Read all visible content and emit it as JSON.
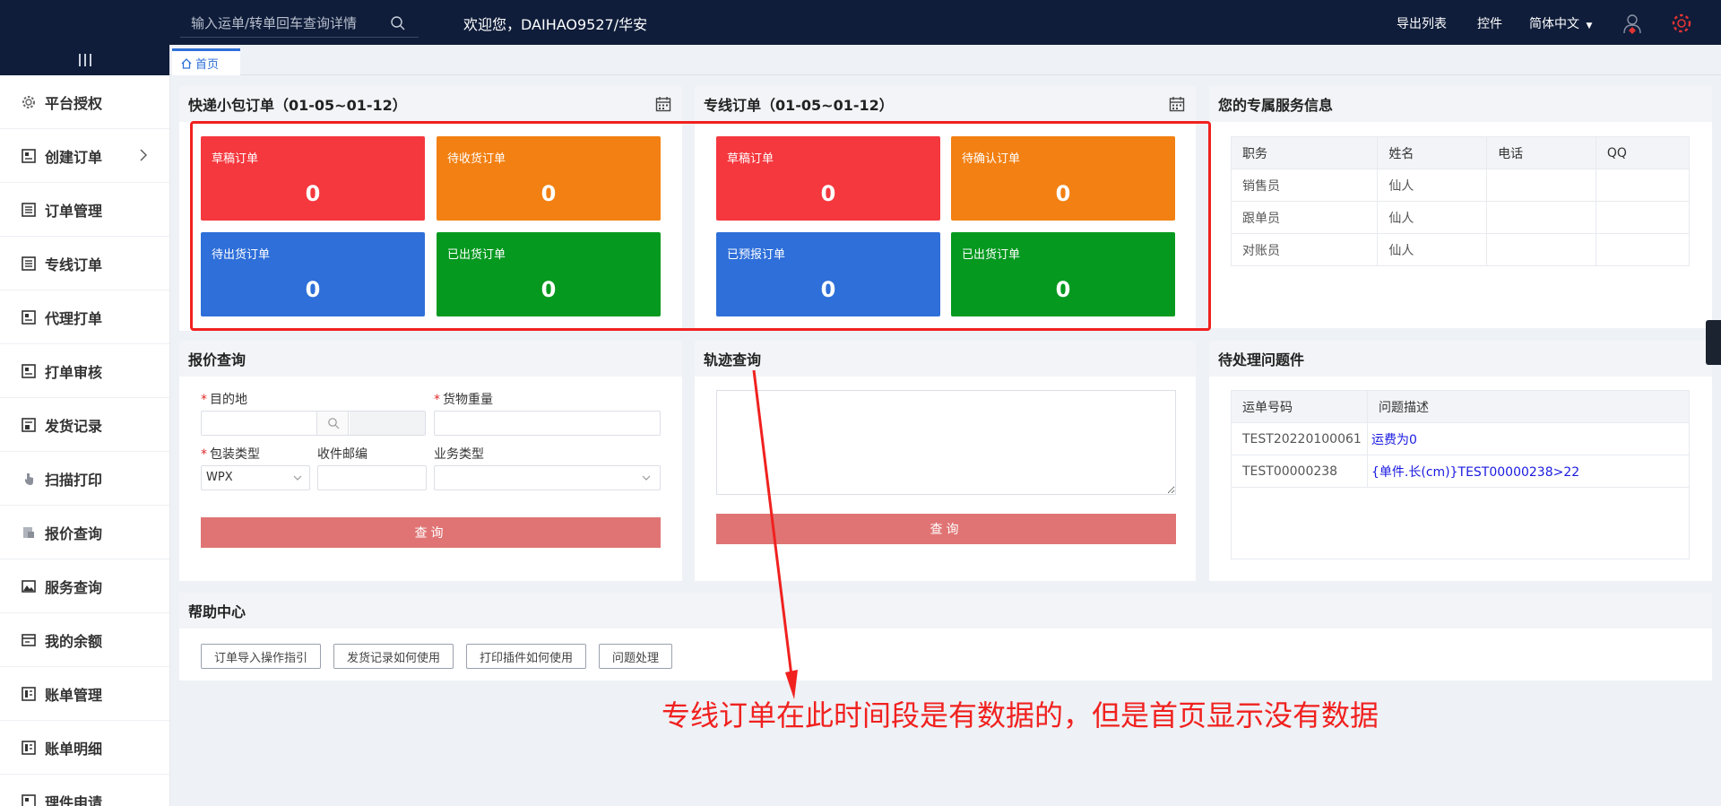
{
  "topbar": {
    "search_placeholder": "输入运单/转单回车查询详情",
    "welcome": "欢迎您，DAIHAO9527/华安",
    "links": [
      "导出列表",
      "控件",
      "简体中文"
    ]
  },
  "sidebar": {
    "items": [
      {
        "label": "平台授权",
        "icon": "gear-icon"
      },
      {
        "label": "创建订单",
        "icon": "form-icon",
        "has_arrow": true
      },
      {
        "label": "订单管理",
        "icon": "list-icon"
      },
      {
        "label": "专线订单",
        "icon": "list-icon"
      },
      {
        "label": "代理打单",
        "icon": "form-icon"
      },
      {
        "label": "打单审核",
        "icon": "form-icon"
      },
      {
        "label": "发货记录",
        "icon": "record-icon"
      },
      {
        "label": "扫描打印",
        "icon": "hand-icon"
      },
      {
        "label": "报价查询",
        "icon": "quote-icon"
      },
      {
        "label": "服务查询",
        "icon": "image-icon"
      },
      {
        "label": "我的余额",
        "icon": "wallet-icon"
      },
      {
        "label": "账单管理",
        "icon": "bill-icon"
      },
      {
        "label": "账单明细",
        "icon": "bill-icon"
      },
      {
        "label": "理件申请",
        "icon": "form-icon"
      }
    ]
  },
  "tabs": [
    {
      "label": "首页"
    }
  ],
  "express_panel": {
    "title": "快递小包订单（01-05~01-12）",
    "tiles": [
      {
        "label": "草稿订单",
        "value": "0"
      },
      {
        "label": "待收货订单",
        "value": "0"
      },
      {
        "label": "待出货订单",
        "value": "0"
      },
      {
        "label": "已出货订单",
        "value": "0"
      }
    ]
  },
  "line_panel": {
    "title": "专线订单（01-05~01-12）",
    "tiles": [
      {
        "label": "草稿订单",
        "value": "0"
      },
      {
        "label": "待确认订单",
        "value": "0"
      },
      {
        "label": "已预报订单",
        "value": "0"
      },
      {
        "label": "已出货订单",
        "value": "0"
      }
    ]
  },
  "service_panel": {
    "title": "您的专属服务信息",
    "headers": [
      "职务",
      "姓名",
      "电话",
      "QQ"
    ],
    "rows": [
      [
        "销售员",
        "仙人",
        "",
        ""
      ],
      [
        "跟单员",
        "仙人",
        "",
        ""
      ],
      [
        "对账员",
        "仙人",
        "",
        ""
      ]
    ]
  },
  "quote_panel": {
    "title": "报价查询",
    "destination_label": "目的地",
    "weight_label": "货物重量",
    "package_label": "包装类型",
    "package_value": "WPX",
    "postcode_label": "收件邮编",
    "business_label": "业务类型",
    "button": "查询"
  },
  "track_panel": {
    "title": "轨迹查询",
    "button": "查询"
  },
  "issues_panel": {
    "title": "待处理问题件",
    "headers": [
      "运单号码",
      "问题描述"
    ],
    "rows": [
      [
        "TEST20220100061",
        "运费为0"
      ],
      [
        "TEST00000238",
        "{单件.长(cm)}TEST00000238>22"
      ]
    ]
  },
  "help_panel": {
    "title": "帮助中心",
    "buttons": [
      "订单导入操作指引",
      "发货记录如何使用",
      "打印插件如何使用",
      "问题处理"
    ]
  },
  "annotation": {
    "text": "专线订单在此时间段是有数据的，但是首页显示没有数据",
    "color": "#f0211f"
  },
  "colors": {
    "topbar": "#0f1d3a",
    "tile_red": "#f5383e",
    "tile_orange": "#f28012",
    "tile_blue": "#2e6fd9",
    "tile_green": "#05991f",
    "query_button": "#e07474",
    "link_blue": "#1a1ae0"
  }
}
